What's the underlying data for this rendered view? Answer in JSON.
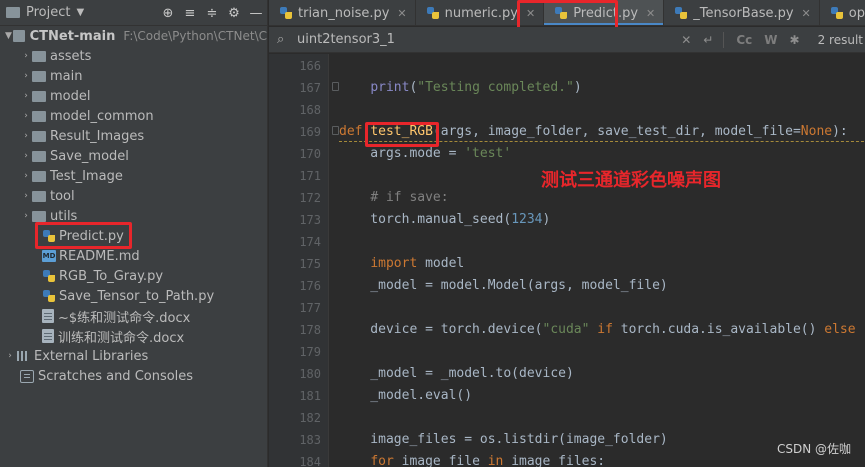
{
  "project_panel": {
    "title": "Project",
    "root": {
      "name": "CTNet-main",
      "path": "F:\\Code\\Python\\CTNet\\C"
    },
    "folders": [
      "assets",
      "main",
      "model",
      "model_common",
      "Result_Images",
      "Save_model",
      "Test_Image",
      "tool",
      "utils"
    ],
    "files": [
      {
        "name": "Predict.py",
        "kind": "py"
      },
      {
        "name": "README.md",
        "kind": "md"
      },
      {
        "name": "RGB_To_Gray.py",
        "kind": "py"
      },
      {
        "name": "Save_Tensor_to_Path.py",
        "kind": "py"
      },
      {
        "name": "~$练和测试命令.docx",
        "kind": "docx"
      },
      {
        "name": "训练和测试命令.docx",
        "kind": "docx"
      }
    ],
    "external_libraries": "External Libraries",
    "scratches": "Scratches and Consoles",
    "md_badge": "MD"
  },
  "tabs": [
    {
      "label": "trian_noise.py",
      "active": false
    },
    {
      "label": "numeric.py",
      "active": false
    },
    {
      "label": "Predict.py",
      "active": true
    },
    {
      "label": "_TensorBase.py",
      "active": false
    },
    {
      "label": "option.py",
      "active": false
    }
  ],
  "search": {
    "query": "uint2tensor3_1",
    "match_case": "Cc",
    "words": "W",
    "results": "2 result"
  },
  "editor": {
    "lines": [
      {
        "n": "166",
        "html": ""
      },
      {
        "n": "167",
        "html": "    <span class='fn2'>print</span>(<span class='str'>\"Testing completed.\"</span>)"
      },
      {
        "n": "168",
        "html": ""
      },
      {
        "n": "169",
        "html": "<span class='kw'>def</span> <span class='fn'>test_RGB</span>(args, image_folder, save_test_dir, model_file=<span class='kw'>None</span>):"
      },
      {
        "n": "170",
        "html": "    args.mode = <span class='str'>'test'</span>"
      },
      {
        "n": "171",
        "html": ""
      },
      {
        "n": "172",
        "html": "    <span class='cm'># if save:</span>"
      },
      {
        "n": "173",
        "html": "    torch.manual_seed(<span class='num'>1234</span>)"
      },
      {
        "n": "174",
        "html": ""
      },
      {
        "n": "175",
        "html": "    <span class='kw'>import</span> model"
      },
      {
        "n": "176",
        "html": "    _model = model.Model(args, model_file)"
      },
      {
        "n": "177",
        "html": ""
      },
      {
        "n": "178",
        "html": "    device = torch.device(<span class='str'>\"cuda\"</span> <span class='kw'>if</span> torch.cuda.is_available() <span class='kw'>else</span>"
      },
      {
        "n": "179",
        "html": ""
      },
      {
        "n": "180",
        "html": "    _model = _model.to(device)"
      },
      {
        "n": "181",
        "html": "    _model.eval()"
      },
      {
        "n": "182",
        "html": ""
      },
      {
        "n": "183",
        "html": "    image_files = os.listdir(image_folder)"
      },
      {
        "n": "184",
        "html": "    <span class='kw'>for</span> image_file <span class='kw'>in</span> image_files:"
      }
    ],
    "annotation": "测试三通道彩色噪声图"
  },
  "watermark": "CSDN @佐咖",
  "colors": {
    "annotation_red": "#e8262b",
    "active_tab_underline": "#4a88c7"
  }
}
